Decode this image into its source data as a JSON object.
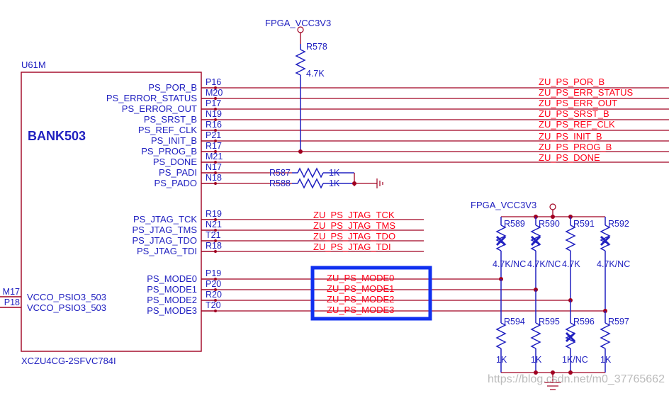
{
  "ic": {
    "refdes": "U61M",
    "bank": "BANK503",
    "part": "XCZU4CG-2SFVC784I"
  },
  "power": {
    "top": "FPGA_VCC3V3",
    "right": "FPGA_VCC3V3"
  },
  "left_pins": {
    "m17": "M17",
    "p18": "P18",
    "vcc1_name": "VCCO_PSIO3_503",
    "vcc2_name": "VCCO_PSIO3_503"
  },
  "ps_pins": [
    {
      "num": "P16",
      "name": "PS_POR_B",
      "net": "ZU_PS_POR_B"
    },
    {
      "num": "M20",
      "name": "PS_ERROR_STATUS",
      "net": "ZU_PS_ERR_STATUS"
    },
    {
      "num": "P17",
      "name": "PS_ERROR_OUT",
      "net": "ZU_PS_ERR_OUT"
    },
    {
      "num": "N19",
      "name": "PS_SRST_B",
      "net": "ZU_PS_SRST_B"
    },
    {
      "num": "R16",
      "name": "PS_REF_CLK",
      "net": "ZU_PS_REF_CLK"
    },
    {
      "num": "P21",
      "name": "PS_INIT_B",
      "net": "ZU_PS_INIT_B"
    },
    {
      "num": "R17",
      "name": "PS_PROG_B",
      "net": "ZU_PS_PROG_B"
    },
    {
      "num": "M21",
      "name": "PS_DONE",
      "net": "ZU_PS_DONE"
    }
  ],
  "padi": {
    "num": "N17",
    "name": "PS_PADI"
  },
  "pado": {
    "num": "N18",
    "name": "PS_PADO"
  },
  "jtag": [
    {
      "num": "R19",
      "name": "PS_JTAG_TCK",
      "net": "ZU_PS_JTAG_TCK"
    },
    {
      "num": "N21",
      "name": "PS_JTAG_TMS",
      "net": "ZU_PS_JTAG_TMS"
    },
    {
      "num": "T21",
      "name": "PS_JTAG_TDO",
      "net": "ZU_PS_JTAG_TDO"
    },
    {
      "num": "R18",
      "name": "PS_JTAG_TDI",
      "net": "ZU_PS_JTAG_TDI"
    }
  ],
  "modes": [
    {
      "num": "P19",
      "name": "PS_MODE0",
      "net": "ZU_PS_MODE0"
    },
    {
      "num": "P20",
      "name": "PS_MODE1",
      "net": "ZU_PS_MODE1"
    },
    {
      "num": "R20",
      "name": "PS_MODE2",
      "net": "ZU_PS_MODE2"
    },
    {
      "num": "T20",
      "name": "PS_MODE3",
      "net": "ZU_PS_MODE3"
    }
  ],
  "resistors": {
    "r578": {
      "ref": "R578",
      "val": "4.7K"
    },
    "r587": {
      "ref": "R587",
      "val": "1K"
    },
    "r588": {
      "ref": "R588",
      "val": "1K"
    },
    "top": [
      {
        "ref": "R589",
        "val": "4.7K/NC",
        "nc": true
      },
      {
        "ref": "R590",
        "val": "4.7K/NC",
        "nc": true
      },
      {
        "ref": "R591",
        "val": "4.7K",
        "nc": false
      },
      {
        "ref": "R592",
        "val": "4.7K/NC",
        "nc": true
      }
    ],
    "bot": [
      {
        "ref": "R594",
        "val": "1K",
        "nc": false
      },
      {
        "ref": "R595",
        "val": "1K",
        "nc": false
      },
      {
        "ref": "R596",
        "val": "1K/NC",
        "nc": true
      },
      {
        "ref": "R597",
        "val": "1K",
        "nc": false
      }
    ]
  },
  "watermark": "https://blog.csdn.net/m0_37765662"
}
